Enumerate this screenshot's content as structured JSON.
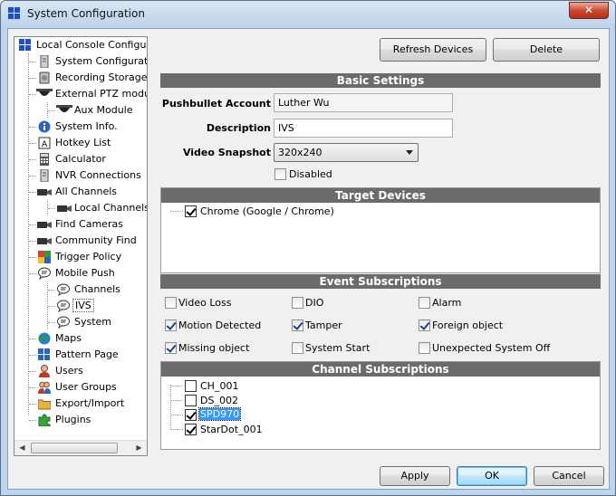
{
  "window": {
    "title": "System Configuration",
    "close_label": "✕"
  },
  "tree": {
    "items": [
      {
        "label": "Local Console Configuration",
        "icon": "windows-logo-icon"
      },
      {
        "label": "System Configuration",
        "icon": "server-icon"
      },
      {
        "label": "Recording Storage Settings",
        "icon": "storage-drive-icon"
      },
      {
        "label": "External PTZ module",
        "icon": "ptz-dome-camera-icon"
      },
      {
        "label": "Aux Module",
        "icon": "dome-camera-icon"
      },
      {
        "label": "System Info.",
        "icon": "info-icon"
      },
      {
        "label": "Hotkey List",
        "icon": "keyboard-key-icon"
      },
      {
        "label": "Calculator",
        "icon": "calculator-icon"
      },
      {
        "label": "NVR Connections",
        "icon": "server-icon"
      },
      {
        "label": "All Channels",
        "icon": "camera-icon"
      },
      {
        "label": "Local Channels",
        "icon": "camera-icon"
      },
      {
        "label": "Find Cameras",
        "icon": "camera-icon"
      },
      {
        "label": "Community Find",
        "icon": "camera-icon"
      },
      {
        "label": "Trigger Policy",
        "icon": "trigger-grid-icon"
      },
      {
        "label": "Mobile Push",
        "icon": "speech-bubble-icon"
      },
      {
        "label": "Channels",
        "icon": "speech-bubble-icon"
      },
      {
        "label": "IVS",
        "icon": "speech-bubble-icon"
      },
      {
        "label": "System",
        "icon": "speech-bubble-icon"
      },
      {
        "label": "Maps",
        "icon": "globe-icon"
      },
      {
        "label": "Pattern Page",
        "icon": "pattern-grid-icon"
      },
      {
        "label": "Users",
        "icon": "user-icon"
      },
      {
        "label": "User Groups",
        "icon": "user-group-icon"
      },
      {
        "label": "Export/Import",
        "icon": "folder-icon"
      },
      {
        "label": "Plugins",
        "icon": "puzzle-icon"
      }
    ]
  },
  "toolbar": {
    "refresh_label": "Refresh Devices",
    "delete_label": "Delete"
  },
  "basic": {
    "header": "Basic Settings",
    "account_label": "Pushbullet Account",
    "account_value": "Luther Wu",
    "description_label": "Description",
    "description_value": "IVS",
    "snapshot_label": "Video Snapshot",
    "snapshot_value": "320x240",
    "disabled_label": "Disabled",
    "disabled_checked": false
  },
  "target": {
    "header": "Target Devices",
    "devices": [
      {
        "label": "Chrome (Google / Chrome)",
        "checked": true
      }
    ]
  },
  "events": {
    "header": "Event Subscriptions",
    "items": [
      {
        "label": "Video Loss",
        "checked": false
      },
      {
        "label": "DIO",
        "checked": false
      },
      {
        "label": "Alarm",
        "checked": false
      },
      {
        "label": "Motion Detected",
        "checked": true
      },
      {
        "label": "Tamper",
        "checked": true
      },
      {
        "label": "Foreign object",
        "checked": true
      },
      {
        "label": "Missing object",
        "checked": true
      },
      {
        "label": "System Start",
        "checked": false
      },
      {
        "label": "Unexpected System Off",
        "checked": false
      }
    ]
  },
  "channels": {
    "header": "Channel Subscriptions",
    "items": [
      {
        "label": "CH_001",
        "checked": false
      },
      {
        "label": "DS_002",
        "checked": false
      },
      {
        "label": "SPD970",
        "checked": true,
        "selected": true
      },
      {
        "label": "StarDot_001",
        "checked": true
      }
    ]
  },
  "footer": {
    "apply_label": "Apply",
    "ok_label": "OK",
    "cancel_label": "Cancel"
  }
}
